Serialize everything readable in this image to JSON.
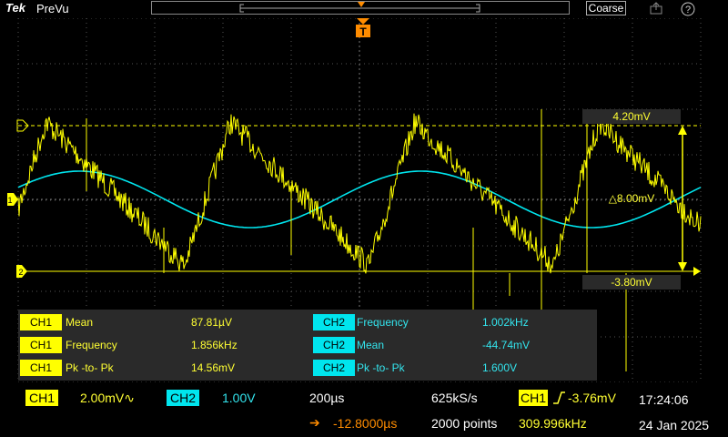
{
  "header": {
    "brand": "Tek",
    "mode": "PreVu",
    "coarse": "Coarse"
  },
  "trigger_marker": "T",
  "cursors": {
    "upper": "4.20mV",
    "delta": "△8.00mV",
    "lower": "-3.80mV"
  },
  "channel_markers": {
    "ch1": "1",
    "ch2": "2"
  },
  "measurements": {
    "ch1": [
      {
        "badge": "CH1",
        "label": "Mean",
        "value": "87.81µV"
      },
      {
        "badge": "CH1",
        "label": "Frequency",
        "value": "1.856kHz"
      },
      {
        "badge": "CH1",
        "label": "Pk -to- Pk",
        "value": "14.56mV"
      }
    ],
    "ch2": [
      {
        "badge": "CH2",
        "label": "Frequency",
        "value": "1.002kHz"
      },
      {
        "badge": "CH2",
        "label": "Mean",
        "value": "-44.74mV"
      },
      {
        "badge": "CH2",
        "label": "Pk -to- Pk",
        "value": "1.600V"
      }
    ]
  },
  "status": {
    "ch1_badge": "CH1",
    "ch1_scale": "2.00mV∿",
    "ch2_badge": "CH2",
    "ch2_scale": "1.00V",
    "timebase": "200µs",
    "sample_rate": "625kS/s",
    "trig_badge": "CH1",
    "trig_level": "-3.76mV",
    "time": "17:24:06",
    "position_icon": "➔",
    "position": "-12.8000µs",
    "record_length": "2000 points",
    "trig_freq": "309.996kHz",
    "date": "24 Jan 2025"
  },
  "colors": {
    "ch1": "#ffff00",
    "ch2": "#00e5ee",
    "trigger": "#ff8c00",
    "grid": "#555555"
  }
}
